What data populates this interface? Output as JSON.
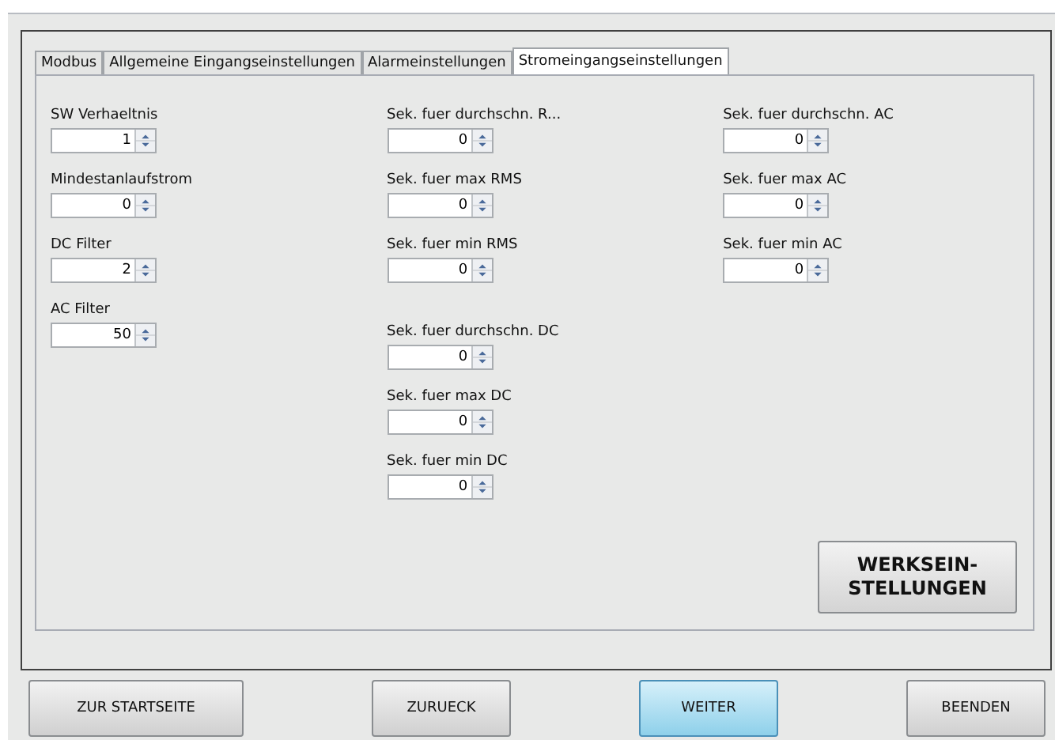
{
  "tabs": [
    {
      "label": "Modbus",
      "selected": false
    },
    {
      "label": "Allgemeine Eingangseinstellungen",
      "selected": false
    },
    {
      "label": "Alarmeinstellungen",
      "selected": false
    },
    {
      "label": "Stromeingangseinstellungen",
      "selected": true
    }
  ],
  "columns": [
    [
      {
        "label": "SW Verhaeltnis",
        "value": "1"
      },
      {
        "label": "Mindestanlaufstrom",
        "value": "0"
      },
      {
        "label": "DC Filter",
        "value": "2"
      },
      {
        "label": "AC Filter",
        "value": "50"
      }
    ],
    [
      {
        "label": "Sek. fuer durchschn. R...",
        "value": "0"
      },
      {
        "label": "Sek. fuer max RMS",
        "value": "0"
      },
      {
        "label": "Sek. fuer min RMS",
        "value": "0"
      },
      {
        "label": "Sek. fuer durchschn. DC",
        "value": "0"
      },
      {
        "label": "Sek. fuer max DC",
        "value": "0"
      },
      {
        "label": "Sek. fuer min DC",
        "value": "0"
      }
    ],
    [
      {
        "label": "Sek. fuer durchschn. AC",
        "value": "0"
      },
      {
        "label": "Sek. fuer max AC",
        "value": "0"
      },
      {
        "label": "Sek. fuer min AC",
        "value": "0"
      }
    ]
  ],
  "factory_button": {
    "lines": [
      "WERKSEIN-",
      "STELLUNGEN"
    ]
  },
  "buttons": [
    {
      "label": "ZUR STARTSEITE",
      "selected": false
    },
    {
      "label": "ZURUECK",
      "selected": false
    },
    {
      "label": "WEITER",
      "selected": true
    },
    {
      "label": "BEENDEN",
      "selected": false
    }
  ]
}
